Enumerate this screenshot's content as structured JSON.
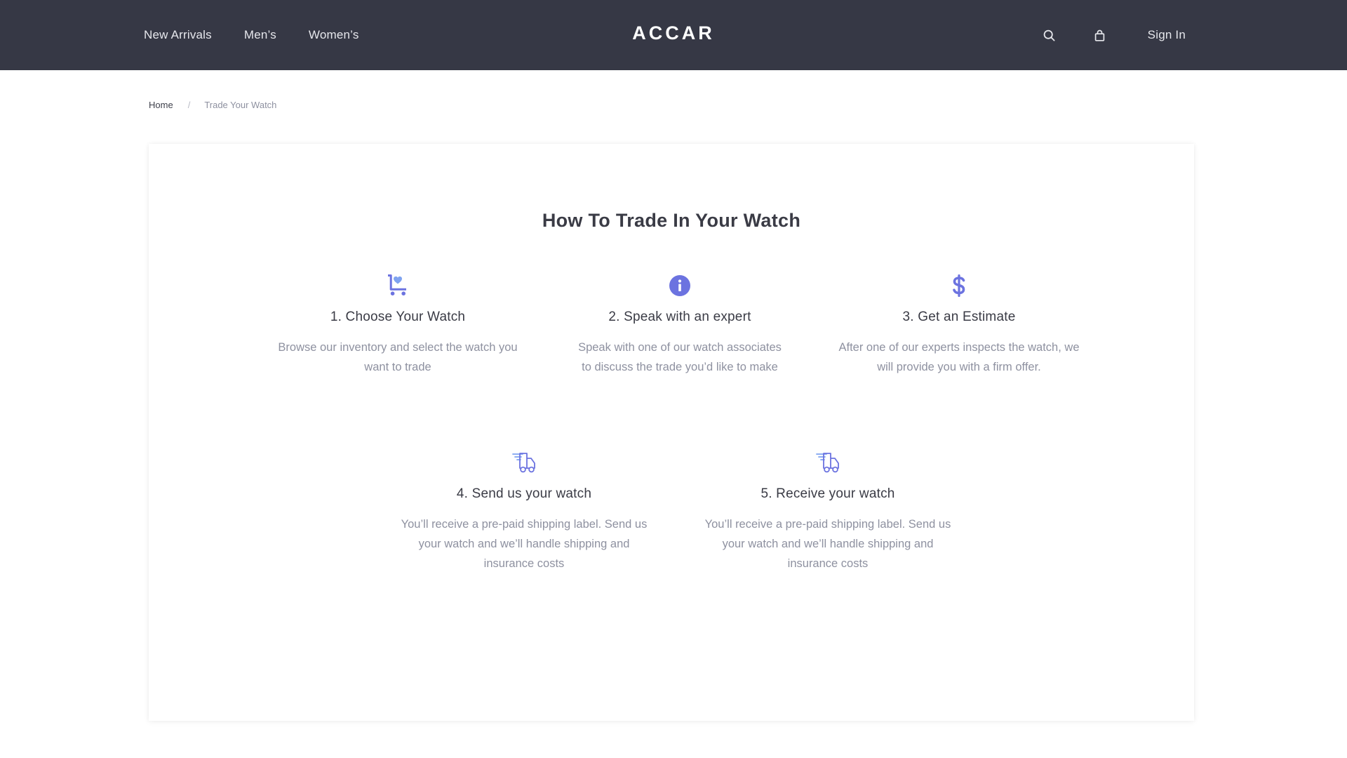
{
  "header": {
    "nav": [
      {
        "label": "New Arrivals"
      },
      {
        "label": "Men’s"
      },
      {
        "label": "Women’s"
      }
    ],
    "logo": "ACCAR",
    "icons": [
      "search-icon",
      "shopping-bag-icon"
    ],
    "sign_in": "Sign In"
  },
  "breadcrumb": {
    "home": "Home",
    "separator": "/",
    "current": "Trade Your Watch"
  },
  "main": {
    "title": "How To Trade In Your Watch",
    "steps": [
      {
        "icon": "cart-heart-icon",
        "title": "1. Choose Your Watch",
        "description": "Browse our inventory and select the watch you want to trade"
      },
      {
        "icon": "info-icon",
        "title": "2. Speak with an expert",
        "description": "Speak with one of our watch associates to discuss the trade you’d like to make"
      },
      {
        "icon": "dollar-icon",
        "title": "3. Get an Estimate",
        "description": "After one of our experts inspects the watch, we will provide you with a firm offer."
      },
      {
        "icon": "shipping-truck-icon",
        "title": "4. Send us your watch",
        "description": "You’ll receive a pre-paid shipping label. Send us your watch and we’ll handle shipping and insurance costs"
      },
      {
        "icon": "shipping-truck-icon",
        "title": "5. Receive your watch",
        "description": "You’ll receive a pre-paid shipping label. Send us your watch and we’ll handle shipping and insurance costs"
      }
    ]
  },
  "colors": {
    "header_bg": "#363845",
    "accent": "#6c73e0",
    "accent_light": "#7fa3f0",
    "text_dark": "#3a3b45",
    "text_muted": "#8e91a0"
  }
}
